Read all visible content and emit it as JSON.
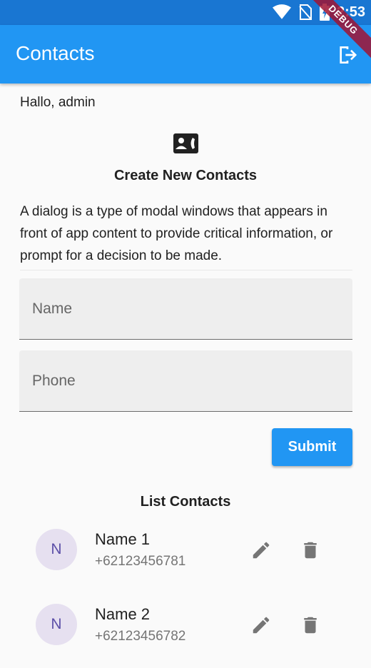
{
  "status_bar": {
    "time": "2:53",
    "debug_label": "DEBUG"
  },
  "app_bar": {
    "title": "Contacts"
  },
  "greeting": "Hallo, admin",
  "create": {
    "title": "Create New Contacts",
    "description": "A dialog is a type of modal windows that appears in front of app content to provide critical information, or prompt for a decision to be made.",
    "name_placeholder": "Name",
    "phone_placeholder": "Phone",
    "submit_label": "Submit"
  },
  "list": {
    "title": "List Contacts",
    "contacts": [
      {
        "initial": "N",
        "name": "Name 1",
        "phone": "+62123456781"
      },
      {
        "initial": "N",
        "name": "Name 2",
        "phone": "+62123456782"
      }
    ]
  },
  "colors": {
    "primary": "#2196f3",
    "status_bar": "#1976d2",
    "avatar_bg": "#e6e0f0",
    "icon_grey": "#757575"
  },
  "icons": {
    "logout": "logout-icon",
    "contact_card": "contact-phone-icon",
    "edit": "edit-icon",
    "delete": "delete-icon"
  }
}
